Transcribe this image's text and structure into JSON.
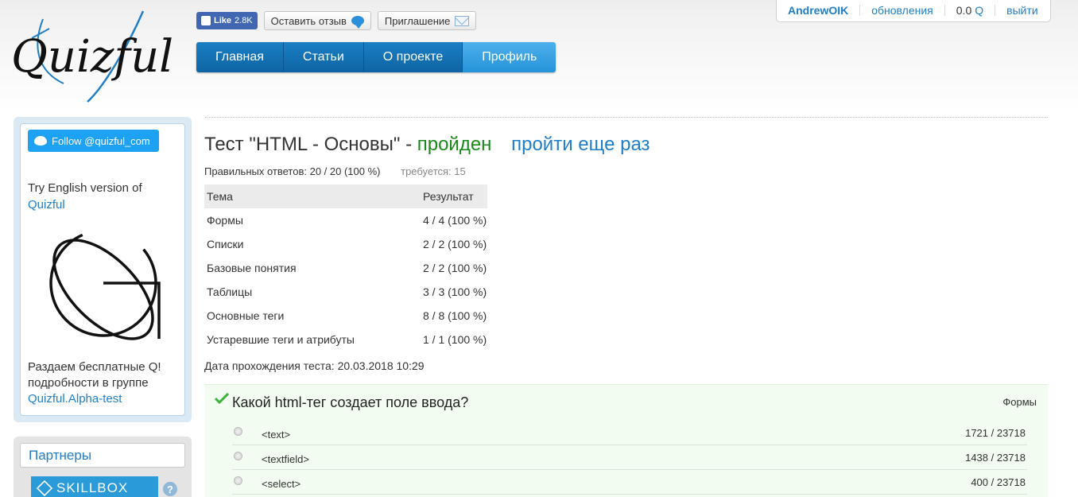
{
  "header": {
    "logo_text": "Quizful",
    "like_label": "Like",
    "like_count": "2.8K",
    "feedback_label": "Оставить отзыв",
    "invite_label": "Приглашение",
    "nav": [
      {
        "label": "Главная"
      },
      {
        "label": "Статьи"
      },
      {
        "label": "О проекте"
      },
      {
        "label": "Профиль"
      }
    ],
    "user": {
      "username": "AndrewOIK",
      "updates": "обновления",
      "balance": "0.0",
      "currency": "Q",
      "logout": "выйти"
    }
  },
  "sidebar": {
    "twitter_label": "Follow @quizful_com",
    "try_text": "Try English version of",
    "try_link": "Quizful",
    "promo_line1": "Раздаем бесплатные Q!",
    "promo_line2": "подробности в группе",
    "promo_link": "Quizful.Alpha-test",
    "partners_title": "Партнеры",
    "skillbox_label": "SKILLBOX",
    "help_glyph": "?"
  },
  "main": {
    "title_prefix": "Тест \"HTML - Основы\" -",
    "status": "пройден",
    "retry": "пройти еще раз",
    "score_text": "Правильных ответов: 20 / 20 (100 %)",
    "required_text": "требуется: 15",
    "table_headers": {
      "topic": "Тема",
      "result": "Результат"
    },
    "table_rows": [
      {
        "topic": "Формы",
        "result": "4 / 4 (100 %)"
      },
      {
        "topic": "Списки",
        "result": "2 / 2 (100 %)"
      },
      {
        "topic": "Базовые понятия",
        "result": "2 / 2 (100 %)"
      },
      {
        "topic": "Таблицы",
        "result": "3 / 3 (100 %)"
      },
      {
        "topic": "Основные теги",
        "result": "8 / 8 (100 %)"
      },
      {
        "topic": "Устаревшие теги и атрибуты",
        "result": "1 / 1 (100 %)"
      }
    ],
    "date_text": "Дата прохождения теста: 20.03.2018 10:29",
    "question": {
      "text": "Какой html-тег создает поле ввода?",
      "topic": "Формы",
      "answers": [
        {
          "label": "<text>",
          "stat": "1721 / 23718"
        },
        {
          "label": "<textfield>",
          "stat": "1438 / 23718"
        },
        {
          "label": "<select>",
          "stat": "400 / 23718"
        }
      ]
    }
  },
  "colors": {
    "accent": "#1f7ec6",
    "nav": "#1a7fc4",
    "nav_active": "#2593d8",
    "passed": "#1a8a1a",
    "twitter": "#1da1f2"
  }
}
